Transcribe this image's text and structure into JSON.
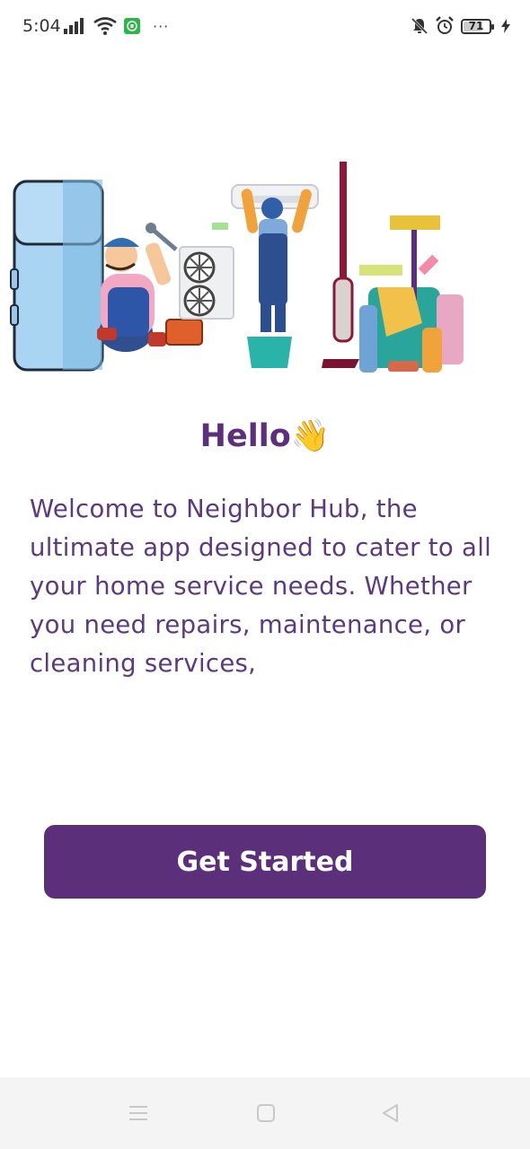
{
  "status_bar": {
    "time": "5:04",
    "battery_percent": "71",
    "icons": [
      "signal-icon",
      "wifi-icon",
      "app-notification-icon",
      "more-icon",
      "mute-icon",
      "alarm-icon",
      "battery-icon",
      "charging-icon"
    ]
  },
  "hero": {
    "greeting": "Hello👋",
    "description": "Welcome to Neighbor Hub, the ultimate app designed to cater to all your home service needs. Whether you need repairs, maintenance, or cleaning services,"
  },
  "cta": {
    "label": "Get Started"
  },
  "colors": {
    "primary": "#5c2f7b",
    "text": "#5b3a7e"
  },
  "navbar": {
    "icons": [
      "menu-icon",
      "home-square-icon",
      "back-triangle-icon"
    ]
  }
}
